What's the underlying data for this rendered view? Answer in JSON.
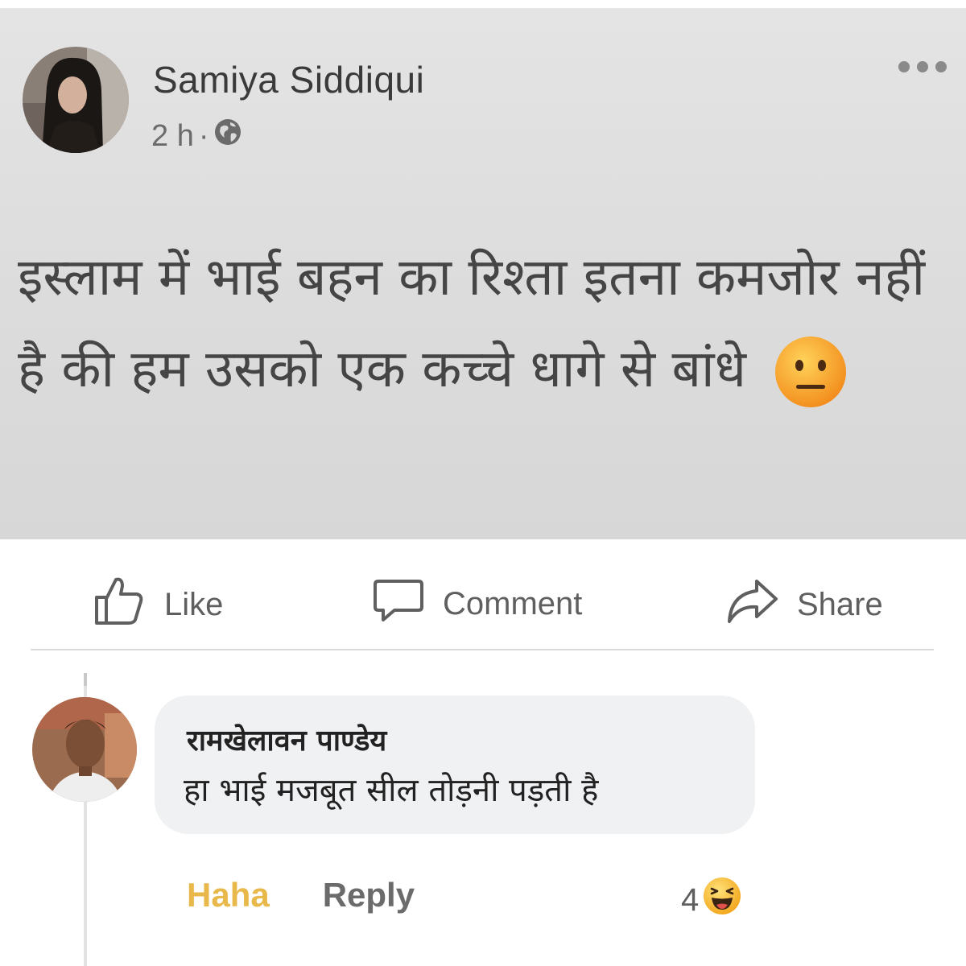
{
  "post": {
    "author": "Samiya Siddiqui",
    "time": "2 h",
    "separator": "·",
    "privacy_icon": "globe-icon",
    "more_icon": "more-dots-icon",
    "text": "इस्लाम में भाई बहन का रिश्ता इतना कमजोर नहीं है की हम उसको एक कच्चे धागे से बांधे",
    "emoji": "neutral-face-emoji"
  },
  "actions": {
    "like_label": "Like",
    "comment_label": "Comment",
    "share_label": "Share",
    "like_icon": "thumbs-up-icon",
    "comment_icon": "speech-bubble-icon",
    "share_icon": "share-arrow-icon"
  },
  "comment": {
    "author": "रामखेलावन पाण्डेय",
    "text": "हा भाई मजबूत सील तोड़नी पड़ती है",
    "haha_label": "Haha",
    "reply_label": "Reply",
    "reaction_count": "4",
    "reaction_icon": "laughing-emoji"
  },
  "colors": {
    "haha": "#e8b84a",
    "post_background": "#dcdcdc",
    "bubble": "#f0f1f3"
  }
}
